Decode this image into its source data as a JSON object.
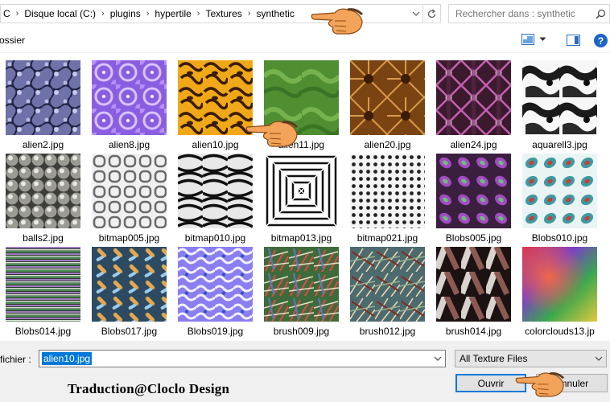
{
  "address_bar": {
    "breadcrumbs": [
      "C",
      "Disque local (C:)",
      "plugins",
      "hypertile",
      "Textures",
      "synthetic"
    ]
  },
  "search": {
    "placeholder": "Rechercher dans : synthetic"
  },
  "toolbar": {
    "new_folder_label": "ossier"
  },
  "files": [
    {
      "name": "alien2.jpg",
      "texture": "alien2"
    },
    {
      "name": "alien8.jpg",
      "texture": "alien8"
    },
    {
      "name": "alien10.jpg",
      "texture": "alien10"
    },
    {
      "name": "alien11.jpg",
      "texture": "alien11"
    },
    {
      "name": "alien20.jpg",
      "texture": "alien20"
    },
    {
      "name": "alien24.jpg",
      "texture": "alien24"
    },
    {
      "name": "aquarell3.jpg",
      "texture": "aquarell3"
    },
    {
      "name": "balls2.jpg",
      "texture": "balls2"
    },
    {
      "name": "bitmap005.jpg",
      "texture": "bitmap005"
    },
    {
      "name": "bitmap010.jpg",
      "texture": "bitmap010"
    },
    {
      "name": "bitmap013.jpg",
      "texture": "bitmap013"
    },
    {
      "name": "bitmap021.jpg",
      "texture": "bitmap021"
    },
    {
      "name": "Blobs005.jpg",
      "texture": "blobs005"
    },
    {
      "name": "Blobs010.jpg",
      "texture": "blobs010"
    },
    {
      "name": "Blobs014.jpg",
      "texture": "blobs014"
    },
    {
      "name": "Blobs017.jpg",
      "texture": "blobs017"
    },
    {
      "name": "Blobs019.jpg",
      "texture": "blobs019"
    },
    {
      "name": "brush009.jpg",
      "texture": "brush009"
    },
    {
      "name": "brush012.jpg",
      "texture": "brush012"
    },
    {
      "name": "brush014.jpg",
      "texture": "brush014"
    },
    {
      "name": "colorclouds13.jp",
      "texture": "colorclouds13"
    }
  ],
  "footer": {
    "filename_label": "fichier :",
    "filename_value": "alien10.jpg",
    "filetype_value": "All Texture Files",
    "open_button": "Ouvrir",
    "cancel_button": "Annuler"
  },
  "credit": "Traduction@Cloclo Design",
  "colors": {
    "selection": "#0078d7",
    "help_icon": "#1c64c8",
    "hand_fill": "#f4a35a"
  }
}
